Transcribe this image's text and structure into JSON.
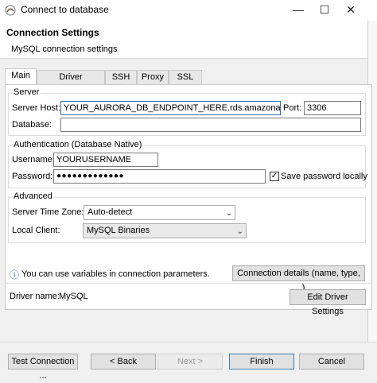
{
  "window": {
    "title": "Connect to database",
    "controls": {
      "minimize": "—",
      "maximize": "☐",
      "close": "✕"
    }
  },
  "header": {
    "title": "Connection Settings",
    "subtitle": "MySQL connection settings"
  },
  "tabs": [
    {
      "label": "Main",
      "active": true
    },
    {
      "label": "Driver properties"
    },
    {
      "label": "SSH"
    },
    {
      "label": "Proxy"
    },
    {
      "label": "SSL"
    }
  ],
  "server": {
    "legend": "Server",
    "host_label": "Server Host:",
    "host_value": "YOUR_AURORA_DB_ENDPOINT_HERE.rds.amazonaws.com",
    "port_label": "Port:",
    "port_value": "3306",
    "database_label": "Database:",
    "database_value": ""
  },
  "auth": {
    "legend": "Authentication (Database Native)",
    "username_label": "Username:",
    "username_value": "YOURUSERNAME",
    "password_label": "Password:",
    "password_value": "●●●●●●●●●●●●●",
    "save_password_label": "Save password locally",
    "save_password_checked": "✓"
  },
  "advanced": {
    "legend": "Advanced",
    "timezone_label": "Server Time Zone:",
    "timezone_value": "Auto-detect",
    "client_label": "Local Client:",
    "client_value": "MySQL Binaries"
  },
  "info": {
    "icon": "ⓘ",
    "text": "You can use variables in connection parameters.",
    "details_button": "Connection details (name, type, ... )"
  },
  "driver": {
    "label": "Driver name:",
    "value": "MySQL",
    "edit_button": "Edit Driver Settings"
  },
  "footer": {
    "test_button": "Test Connection ...",
    "back_button": "< Back",
    "next_button": "Next >",
    "finish_button": "Finish",
    "cancel_button": "Cancel"
  },
  "colors": {
    "focus_border": "#2f6fb5",
    "info_icon": "#1c6fc7"
  }
}
